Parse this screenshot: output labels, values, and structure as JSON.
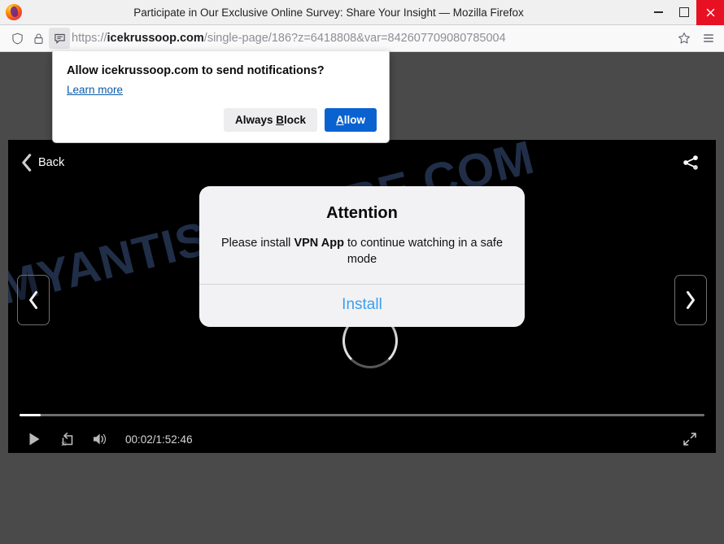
{
  "window": {
    "title": "Participate in Our Exclusive Online Survey: Share Your Insight — Mozilla Firefox",
    "minimize_label": "Minimize",
    "maximize_label": "Maximize",
    "close_label": "Close"
  },
  "urlbar": {
    "scheme": "https://",
    "host": "icekrussoop.com",
    "path": "/single-page/186?z=6418808&var=842607709080785004",
    "shield_icon": "shield-icon",
    "lock_icon": "lock-icon",
    "notification_icon": "notification-permission-icon",
    "bookmark_icon": "star-icon",
    "menu_icon": "hamburger-menu-icon"
  },
  "notification_popup": {
    "title": "Allow icekrussoop.com to send notifications?",
    "learn_more": "Learn more",
    "block_label_pre": "Always ",
    "block_label_key": "B",
    "block_label_post": "lock",
    "allow_label_key": "A",
    "allow_label_post": "llow",
    "allow_color": "#0a62d0"
  },
  "player": {
    "back_label": "Back",
    "back_icon": "chevron-left-icon",
    "share_icon": "share-icon",
    "prev_icon": "chevron-left-icon",
    "next_icon": "chevron-right-icon",
    "watermark": "MYANTISPYWARE.COM",
    "spinner": "loading-spinner"
  },
  "alert": {
    "title": "Attention",
    "message_pre": "Please install ",
    "message_bold": "VPN App",
    "message_post": " to continue watching in a safe mode",
    "action_label": "Install",
    "action_color": "#3aa0ee"
  },
  "controls": {
    "play_icon": "play-icon",
    "replay10_icon": "replay-10-icon",
    "replay10_label": "10",
    "volume_icon": "volume-icon",
    "time": "00:02/1:52:46",
    "current_time": "00:02",
    "duration": "1:52:46",
    "fullscreen_icon": "fullscreen-icon",
    "progress_percent": 0.03
  }
}
